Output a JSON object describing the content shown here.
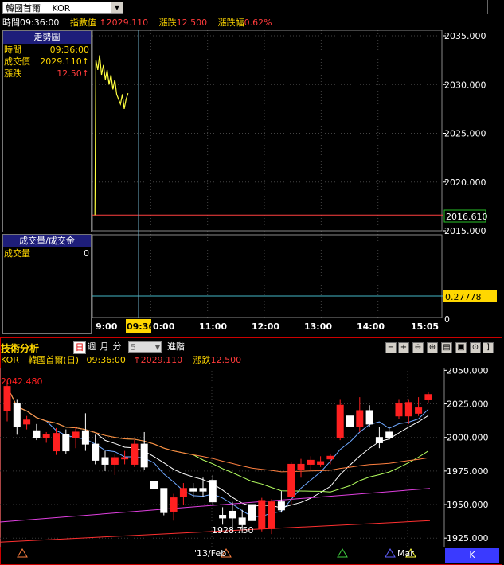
{
  "top": {
    "symbol": "韓國首爾　 KOR",
    "info": {
      "time_label": "時間",
      "time_value": "09:36:00",
      "index_label": "指數值",
      "index_value": "↑2029.110",
      "change_label": "漲跌",
      "change_value": "12.500",
      "pct_label": "漲跌幅",
      "pct_value": "0.62%"
    }
  },
  "trend_panel": {
    "title": "走勢圖",
    "rows": [
      {
        "label": "時間",
        "value": "09:36:00"
      },
      {
        "label": "成交價",
        "value": "2029.110↑"
      },
      {
        "label": "漲跌",
        "value": "12.50↑"
      }
    ]
  },
  "volume_panel": {
    "title": "成交量/成交金",
    "rows": [
      {
        "label": "成交量",
        "value": "0"
      }
    ]
  },
  "intraday_axis": {
    "ticks": [
      "2035.000",
      "2030.000",
      "2025.000",
      "2020.000",
      "2015.000"
    ],
    "ref_label": "2016.610",
    "volume_label": "0.27778",
    "volume_zero": "0"
  },
  "time_axis": {
    "ticks": [
      "9:00",
      "09:36",
      "0:00",
      "11:00",
      "12:00",
      "13:00",
      "14:00",
      "15:05"
    ]
  },
  "technical": {
    "title": "技術分析",
    "timeframes": [
      "日",
      "週",
      "月",
      "分"
    ],
    "minute_value": "5",
    "advanced_label": "進階",
    "tools": [
      "−",
      "+",
      "⊖",
      "⊕",
      "▤",
      "▣",
      "⊙",
      "]"
    ],
    "info": {
      "code": "KOR",
      "name": "韓國首爾(日)",
      "time": "09:36:00",
      "price": "↑2029.110",
      "change_label": "漲跌",
      "change_value": "12.500"
    },
    "high_label": "2042.480",
    "low_label": "1928.750",
    "axis_ticks": [
      "2050.000",
      "2025.000",
      "2000.000",
      "1975.000",
      "1950.000",
      "1925.000"
    ],
    "date_ticks": [
      "'13/Feb",
      "Mar"
    ],
    "k_button": "K"
  },
  "chart_data": [
    {
      "type": "line",
      "title": "",
      "x_range": [
        "09:00",
        "15:05"
      ],
      "ylim": [
        2015,
        2035
      ],
      "reference_value": 2016.61,
      "series": [
        {
          "x": [
            "09:01",
            "09:02",
            "09:04",
            "09:06",
            "09:08",
            "09:10",
            "09:12",
            "09:14",
            "09:16",
            "09:18",
            "09:20",
            "09:22",
            "09:24",
            "09:26",
            "09:28",
            "09:30",
            "09:32",
            "09:34",
            "09:36"
          ],
          "values": [
            2016.6,
            2032.5,
            2031.5,
            2033.0,
            2031.0,
            2032.0,
            2030.5,
            2031.5,
            2030.0,
            2031.0,
            2029.5,
            2030.5,
            2029.0,
            2028.5,
            2028.0,
            2029.0,
            2027.5,
            2028.5,
            2029.11
          ]
        }
      ]
    },
    {
      "type": "candlestick",
      "title": "",
      "ylim": [
        1918,
        2052
      ],
      "candles": [
        {
          "o": 2020,
          "h": 2042,
          "l": 2012,
          "c": 2038
        },
        {
          "o": 2025,
          "h": 2028,
          "l": 2002,
          "c": 2008
        },
        {
          "o": 2010,
          "h": 2016,
          "l": 2006,
          "c": 2013
        },
        {
          "o": 2005,
          "h": 2010,
          "l": 1998,
          "c": 2000
        },
        {
          "o": 2000,
          "h": 2004,
          "l": 1996,
          "c": 2002
        },
        {
          "o": 1990,
          "h": 2007,
          "l": 1987,
          "c": 2003
        },
        {
          "o": 2002,
          "h": 2006,
          "l": 1988,
          "c": 1990
        },
        {
          "o": 2000,
          "h": 2008,
          "l": 1992,
          "c": 2004
        },
        {
          "o": 2005,
          "h": 2018,
          "l": 1990,
          "c": 1995
        },
        {
          "o": 1995,
          "h": 2002,
          "l": 1980,
          "c": 1983
        },
        {
          "o": 1985,
          "h": 1990,
          "l": 1975,
          "c": 1980
        },
        {
          "o": 1980,
          "h": 1988,
          "l": 1972,
          "c": 1985
        },
        {
          "o": 1984,
          "h": 1990,
          "l": 1980,
          "c": 1985
        },
        {
          "o": 1980,
          "h": 1998,
          "l": 1978,
          "c": 1995
        },
        {
          "o": 1995,
          "h": 2004,
          "l": 1976,
          "c": 1978
        },
        {
          "o": 1967,
          "h": 1970,
          "l": 1958,
          "c": 1962
        },
        {
          "o": 1962,
          "h": 1956,
          "l": 1942,
          "c": 1944
        },
        {
          "o": 1945,
          "h": 1958,
          "l": 1938,
          "c": 1955
        },
        {
          "o": 1956,
          "h": 1966,
          "l": 1950,
          "c": 1962
        },
        {
          "o": 1962,
          "h": 1966,
          "l": 1955,
          "c": 1960
        },
        {
          "o": 1962,
          "h": 1970,
          "l": 1956,
          "c": 1960
        },
        {
          "o": 1968,
          "h": 1972,
          "l": 1950,
          "c": 1952
        },
        {
          "o": 1942,
          "h": 1948,
          "l": 1935,
          "c": 1940
        },
        {
          "o": 1945,
          "h": 1952,
          "l": 1930,
          "c": 1940
        },
        {
          "o": 1940,
          "h": 1946,
          "l": 1928.75,
          "c": 1935
        },
        {
          "o": 1950,
          "h": 1956,
          "l": 1932,
          "c": 1938
        },
        {
          "o": 1932,
          "h": 1955,
          "l": 1930,
          "c": 1953
        },
        {
          "o": 1932,
          "h": 1954,
          "l": 1928,
          "c": 1952
        },
        {
          "o": 1952,
          "h": 1960,
          "l": 1944,
          "c": 1946
        },
        {
          "o": 1956,
          "h": 1982,
          "l": 1950,
          "c": 1980
        },
        {
          "o": 1976,
          "h": 1984,
          "l": 1970,
          "c": 1980
        },
        {
          "o": 1980,
          "h": 1986,
          "l": 1975,
          "c": 1983
        },
        {
          "o": 1980,
          "h": 1986,
          "l": 1978,
          "c": 1982
        },
        {
          "o": 1984,
          "h": 1988,
          "l": 1980,
          "c": 1986
        },
        {
          "o": 2000,
          "h": 2028,
          "l": 1998,
          "c": 2024
        },
        {
          "o": 2016,
          "h": 2022,
          "l": 2004,
          "c": 2008
        },
        {
          "o": 2008,
          "h": 2030,
          "l": 2004,
          "c": 2020
        },
        {
          "o": 2020,
          "h": 2024,
          "l": 2008,
          "c": 2010
        },
        {
          "o": 2000,
          "h": 2008,
          "l": 1992,
          "c": 1996
        },
        {
          "o": 2004,
          "h": 2008,
          "l": 1998,
          "c": 2000
        },
        {
          "o": 2016,
          "h": 2028,
          "l": 2014,
          "c": 2025
        },
        {
          "o": 2016,
          "h": 2028,
          "l": 2010,
          "c": 2026
        },
        {
          "o": 2018,
          "h": 2030,
          "l": 2016,
          "c": 2022
        },
        {
          "o": 2028,
          "h": 2034,
          "l": 2026,
          "c": 2032
        }
      ]
    }
  ],
  "colors": {
    "accent": "#1e1e7a",
    "up": "#ff2020",
    "down": "#ffffff",
    "yellow": "#ffd700",
    "frame": "#cc0000"
  }
}
